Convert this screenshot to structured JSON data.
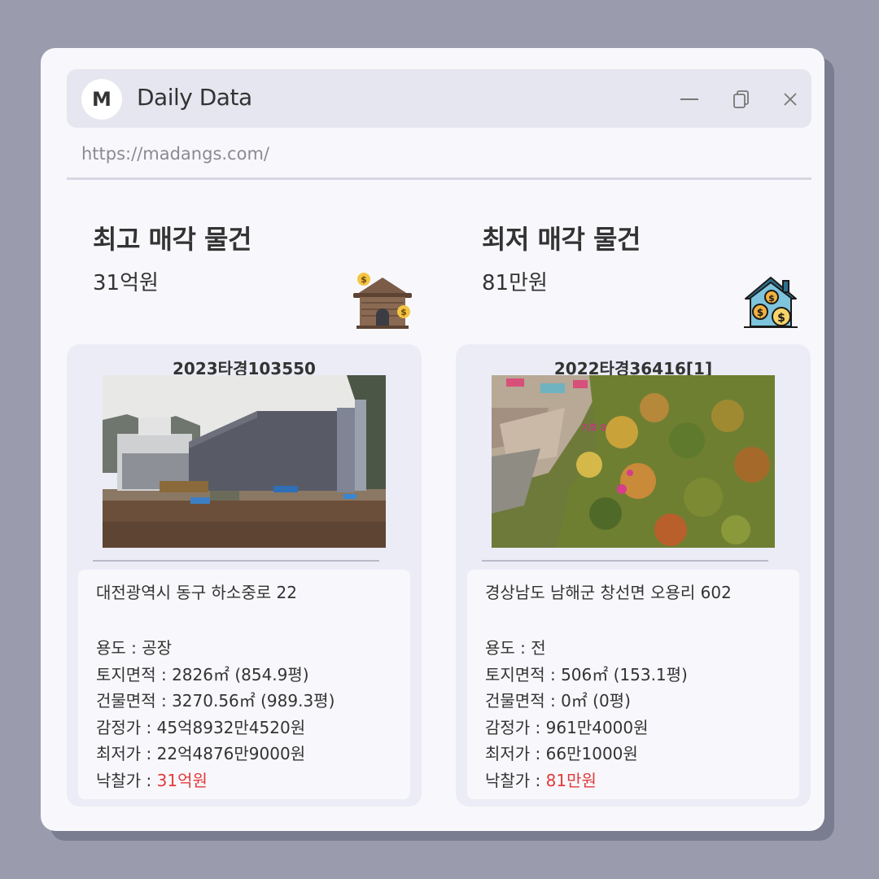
{
  "app": {
    "logo_letter": "M",
    "title": "Daily Data",
    "url": "https://madangs.com/"
  },
  "highest": {
    "heading": "최고 매각 물건",
    "value": "31억원",
    "icon": "house-money-icon",
    "case_no": "2023타경103550",
    "address": "대전광역시 동구 하소중로 22",
    "rows": [
      {
        "label": "용도 : ",
        "value": "공장"
      },
      {
        "label": "토지면적 : ",
        "value": "2826㎡ (854.9평)"
      },
      {
        "label": "건물면적 : ",
        "value": "3270.56㎡ (989.3평)"
      },
      {
        "label": "감정가 : ",
        "value": "45억8932만4520원"
      },
      {
        "label": "최저가 : ",
        "value": "22억4876만9000원"
      },
      {
        "label": "낙찰가 : ",
        "value": "31억원"
      }
    ]
  },
  "lowest": {
    "heading": "최저 매각 물건",
    "value": "81만원",
    "icon": "house-coins-icon",
    "case_no": "2022타경36416[1]",
    "address": "경상남도 남해군 창선면 오용리 602",
    "rows": [
      {
        "label": "용도 : ",
        "value": "전"
      },
      {
        "label": "토지면적 : ",
        "value": "506㎡ (153.1평)"
      },
      {
        "label": "건물면적 : ",
        "value": "0㎡ (0평)"
      },
      {
        "label": "감정가 : ",
        "value": "961만4000원"
      },
      {
        "label": "최저가 : ",
        "value": "66만1000원"
      },
      {
        "label": "낙찰가 : ",
        "value": "81만원"
      }
    ]
  },
  "photo_annotation": "기호 8",
  "colors": {
    "background": "#9a9cae",
    "window": "#f8f8fc",
    "card": "#ebecf6",
    "accent_price": "#e23a3a"
  }
}
